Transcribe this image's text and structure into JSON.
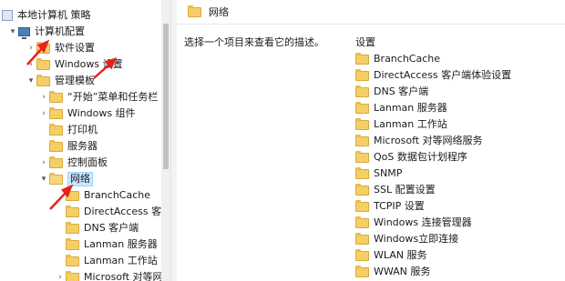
{
  "tree": {
    "root": "本地计算机 策略",
    "computer_config": "计算机配置",
    "software_settings": "软件设置",
    "windows_settings": "Windows 设置",
    "admin_templates": "管理模板",
    "start_menu": "“开始”菜单和任务栏",
    "windows_components": "Windows 组件",
    "printers": "打印机",
    "server": "服务器",
    "control_panel": "控制面板",
    "network": "网络",
    "children": [
      "BranchCache",
      "DirectAccess 客户",
      "DNS 客户端",
      "Lanman 服务器",
      "Lanman 工作站",
      "Microsoft 对等网"
    ]
  },
  "right_panel": {
    "title": "网络",
    "description": "选择一个项目来查看它的描述。",
    "column_header": "设置",
    "items": [
      "BranchCache",
      "DirectAccess 客户端体验设置",
      "DNS 客户端",
      "Lanman 服务器",
      "Lanman 工作站",
      "Microsoft 对等网络服务",
      "QoS 数据包计划程序",
      "SNMP",
      "SSL 配置设置",
      "TCPIP 设置",
      "Windows 连接管理器",
      "Windows立即连接",
      "WLAN 服务",
      "WWAN 服务"
    ]
  },
  "colors": {
    "arrow": "#e8211c",
    "selection": "#cce8ff",
    "folder": "#f5cf66"
  },
  "icons": {
    "tree_folder": "folder-icon",
    "expand": "chevron-right-icon",
    "collapse": "chevron-down-icon"
  }
}
